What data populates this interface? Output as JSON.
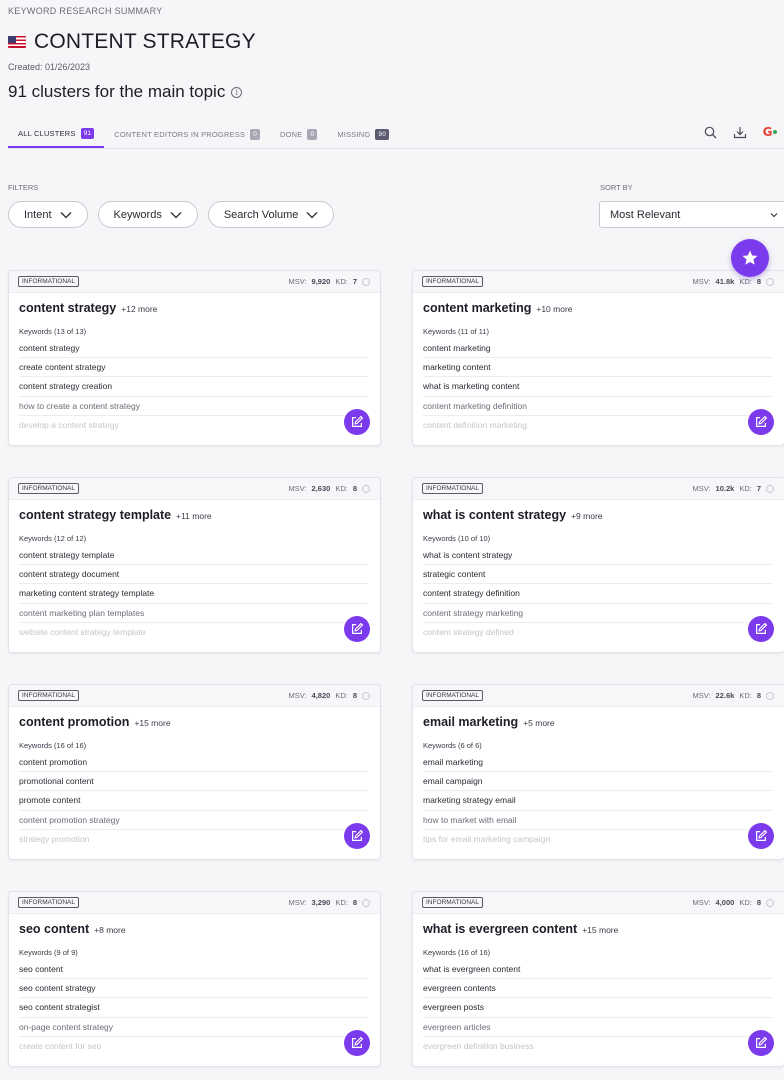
{
  "header": {
    "eyebrow": "KEYWORD RESEARCH SUMMARY",
    "title": "CONTENT STRATEGY",
    "created": "Created: 01/26/2023",
    "subtitle": "91 clusters for the main topic"
  },
  "tabs": [
    {
      "label": "ALL CLUSTERS",
      "count": "91",
      "active": true
    },
    {
      "label": "CONTENT EDITORS IN PROGRESS",
      "count": "0",
      "active": false
    },
    {
      "label": "DONE",
      "count": "0",
      "active": false
    },
    {
      "label": "MISSING",
      "count": "90",
      "active": false
    }
  ],
  "toolbar_icons": [
    "search-icon",
    "download-icon",
    "google-icon"
  ],
  "filters": {
    "label": "FILTERS",
    "pills": [
      "Intent",
      "Keywords",
      "Search Volume"
    ]
  },
  "sort": {
    "label": "SORT BY",
    "value": "Most Relevant"
  },
  "colors": {
    "accent": "#7c3aed",
    "background": "#f6f6f9"
  },
  "clusters": [
    {
      "intent": "INFORMATIONAL",
      "msv_label": "MSV:",
      "msv": "9,920",
      "kd_label": "KD:",
      "kd": "7",
      "title": "content strategy",
      "more": "+12 more",
      "keywords_label": "Keywords (13 of 13)",
      "keywords": [
        "content strategy",
        "create content strategy",
        "content strategy creation",
        "how to create a content strategy",
        "develop a content strategy"
      ]
    },
    {
      "intent": "INFORMATIONAL",
      "msv_label": "MSV:",
      "msv": "41.8k",
      "kd_label": "KD:",
      "kd": "8",
      "title": "content marketing",
      "more": "+10 more",
      "keywords_label": "Keywords (11 of 11)",
      "keywords": [
        "content marketing",
        "marketing content",
        "what is marketing content",
        "content marketing definition",
        "content definition marketing"
      ]
    },
    {
      "intent": "INFORMATIONAL",
      "msv_label": "MSV:",
      "msv": "2,630",
      "kd_label": "KD:",
      "kd": "8",
      "title": "content strategy template",
      "more": "+11 more",
      "keywords_label": "Keywords (12 of 12)",
      "keywords": [
        "content strategy template",
        "content strategy document",
        "marketing content strategy template",
        "content marketing plan templates",
        "website content strategy template"
      ]
    },
    {
      "intent": "INFORMATIONAL",
      "msv_label": "MSV:",
      "msv": "10.2k",
      "kd_label": "KD:",
      "kd": "7",
      "title": "what is content strategy",
      "more": "+9 more",
      "keywords_label": "Keywords (10 of 10)",
      "keywords": [
        "what is content strategy",
        "strategic content",
        "content strategy definition",
        "content strategy marketing",
        "content strategy defined"
      ]
    },
    {
      "intent": "INFORMATIONAL",
      "msv_label": "MSV:",
      "msv": "4,820",
      "kd_label": "KD:",
      "kd": "8",
      "title": "content promotion",
      "more": "+15 more",
      "keywords_label": "Keywords (16 of 16)",
      "keywords": [
        "content promotion",
        "promotional content",
        "promote content",
        "content promotion strategy",
        "strategy promotion"
      ]
    },
    {
      "intent": "INFORMATIONAL",
      "msv_label": "MSV:",
      "msv": "22.6k",
      "kd_label": "KD:",
      "kd": "8",
      "title": "email marketing",
      "more": "+5 more",
      "keywords_label": "Keywords (6 of 6)",
      "keywords": [
        "email marketing",
        "email campaign",
        "marketing strategy email",
        "how to market with email",
        "tips for email marketing campaign"
      ]
    },
    {
      "intent": "INFORMATIONAL",
      "msv_label": "MSV:",
      "msv": "3,290",
      "kd_label": "KD:",
      "kd": "8",
      "title": "seo content",
      "more": "+8 more",
      "keywords_label": "Keywords (9 of 9)",
      "keywords": [
        "seo content",
        "seo content strategy",
        "seo content strategist",
        "on-page content strategy",
        "create content for seo"
      ]
    },
    {
      "intent": "INFORMATIONAL",
      "msv_label": "MSV:",
      "msv": "4,000",
      "kd_label": "KD:",
      "kd": "8",
      "title": "what is evergreen content",
      "more": "+15 more",
      "keywords_label": "Keywords (16 of 16)",
      "keywords": [
        "what is evergreen content",
        "evergreen contents",
        "evergreen posts",
        "evergreen articles",
        "evergreen definition business"
      ]
    }
  ]
}
